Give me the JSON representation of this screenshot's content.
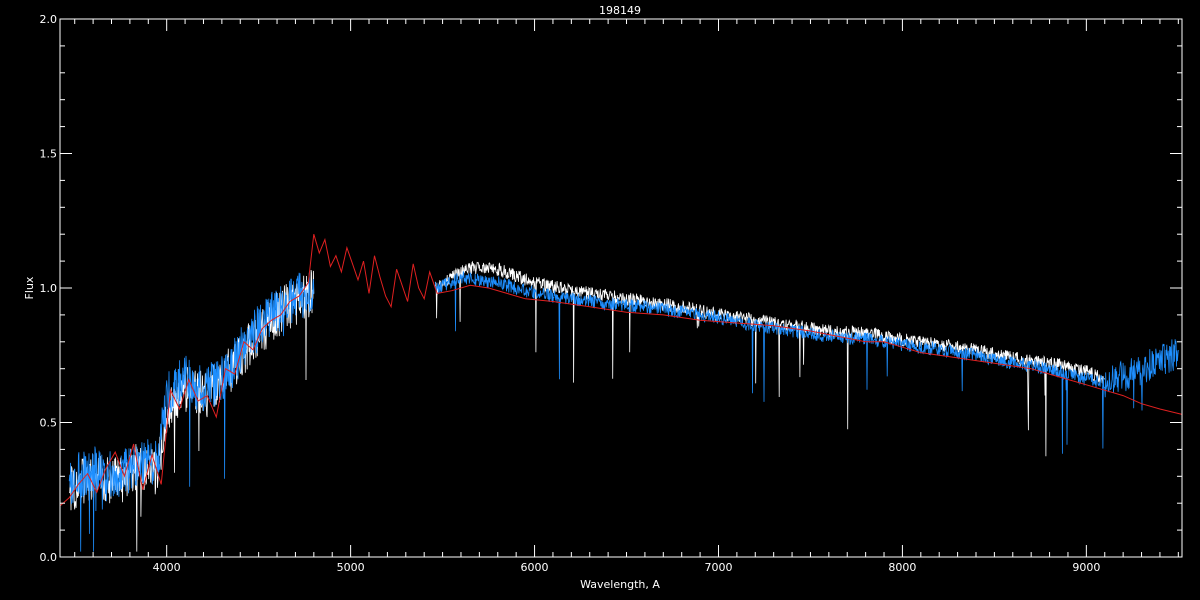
{
  "chart_data": {
    "type": "line",
    "title": "198149",
    "xlabel": "Wavelength, A",
    "ylabel": "Flux",
    "xlim": [
      3420,
      9520
    ],
    "ylim": [
      0.0,
      2.0
    ],
    "x_ticks": [
      4000,
      5000,
      6000,
      7000,
      8000,
      9000
    ],
    "x_tick_labels": [
      "4000",
      "5000",
      "6000",
      "7000",
      "8000",
      "9000"
    ],
    "y_ticks": [
      0.0,
      0.5,
      1.0,
      1.5,
      2.0
    ],
    "y_tick_labels": [
      "0.0",
      "0.5",
      "1.0",
      "1.5",
      "2.0"
    ],
    "grid": false,
    "background_color": "#000000",
    "axis_color": "#ffffff",
    "series": [
      {
        "style": "noisy-spectrum",
        "color": "#ffffff",
        "x": [
          3470,
          3600,
          3750,
          3850,
          3950,
          4000,
          4100,
          4200,
          4300,
          4400,
          4500,
          4600,
          4700,
          4790,
          5470,
          5600,
          5700,
          5800,
          6000,
          6200,
          6400,
          6600,
          6800,
          7000,
          7200,
          7400,
          7600,
          7800,
          8000,
          8200,
          8400,
          8600,
          8800,
          9000,
          9100
        ],
        "values": [
          0.25,
          0.3,
          0.28,
          0.35,
          0.3,
          0.55,
          0.62,
          0.6,
          0.65,
          0.75,
          0.83,
          0.9,
          0.95,
          0.98,
          1.0,
          1.06,
          1.08,
          1.07,
          1.02,
          0.99,
          0.97,
          0.95,
          0.93,
          0.9,
          0.88,
          0.86,
          0.84,
          0.83,
          0.81,
          0.79,
          0.77,
          0.74,
          0.72,
          0.69,
          0.66
        ]
      },
      {
        "style": "noisy-spectrum",
        "color": "#1e8fff",
        "x": [
          3470,
          3600,
          3750,
          3850,
          3950,
          4000,
          4100,
          4200,
          4300,
          4400,
          4500,
          4600,
          4700,
          4790,
          5470,
          5600,
          5700,
          5800,
          6000,
          6200,
          6400,
          6600,
          6800,
          7000,
          7200,
          7400,
          7600,
          7800,
          8000,
          8200,
          8400,
          8600,
          8800,
          9000,
          9100,
          9200,
          9300,
          9400,
          9500
        ],
        "values": [
          0.28,
          0.33,
          0.3,
          0.36,
          0.34,
          0.6,
          0.66,
          0.62,
          0.66,
          0.76,
          0.85,
          0.92,
          0.96,
          1.0,
          1.0,
          1.04,
          1.03,
          1.02,
          0.98,
          0.96,
          0.94,
          0.93,
          0.91,
          0.89,
          0.86,
          0.84,
          0.82,
          0.81,
          0.79,
          0.77,
          0.75,
          0.72,
          0.7,
          0.66,
          0.65,
          0.67,
          0.7,
          0.73,
          0.76
        ]
      },
      {
        "style": "model-curve",
        "color": "#e02020",
        "x": [
          3420,
          3470,
          3520,
          3570,
          3620,
          3670,
          3720,
          3770,
          3820,
          3870,
          3920,
          3970,
          4020,
          4070,
          4120,
          4170,
          4220,
          4270,
          4320,
          4370,
          4420,
          4470,
          4520,
          4570,
          4620,
          4670,
          4720,
          4770,
          4800,
          4830,
          4860,
          4890,
          4920,
          4950,
          4980,
          5010,
          5040,
          5070,
          5100,
          5130,
          5160,
          5190,
          5220,
          5250,
          5280,
          5310,
          5340,
          5370,
          5400,
          5430,
          5470,
          5550,
          5650,
          5750,
          5850,
          5950,
          6100,
          6300,
          6500,
          6700,
          6900,
          7100,
          7300,
          7500,
          7650,
          7800,
          7900,
          8000,
          8100,
          8200,
          8300,
          8400,
          8500,
          8600,
          8700,
          8800,
          8900,
          9000,
          9100,
          9200,
          9300,
          9400,
          9520
        ],
        "values": [
          0.19,
          0.22,
          0.27,
          0.31,
          0.24,
          0.33,
          0.39,
          0.3,
          0.42,
          0.25,
          0.38,
          0.27,
          0.62,
          0.55,
          0.66,
          0.58,
          0.6,
          0.52,
          0.7,
          0.68,
          0.8,
          0.77,
          0.85,
          0.88,
          0.9,
          0.95,
          0.97,
          1.02,
          1.2,
          1.13,
          1.18,
          1.08,
          1.12,
          1.06,
          1.15,
          1.09,
          1.03,
          1.1,
          0.98,
          1.12,
          1.04,
          0.97,
          0.93,
          1.07,
          1.01,
          0.95,
          1.09,
          1.0,
          0.96,
          1.06,
          0.98,
          0.99,
          1.01,
          1.0,
          0.98,
          0.96,
          0.95,
          0.93,
          0.91,
          0.9,
          0.88,
          0.87,
          0.86,
          0.84,
          0.82,
          0.8,
          0.8,
          0.78,
          0.76,
          0.75,
          0.74,
          0.73,
          0.72,
          0.71,
          0.7,
          0.68,
          0.66,
          0.64,
          0.62,
          0.6,
          0.57,
          0.55,
          0.53
        ]
      }
    ]
  }
}
